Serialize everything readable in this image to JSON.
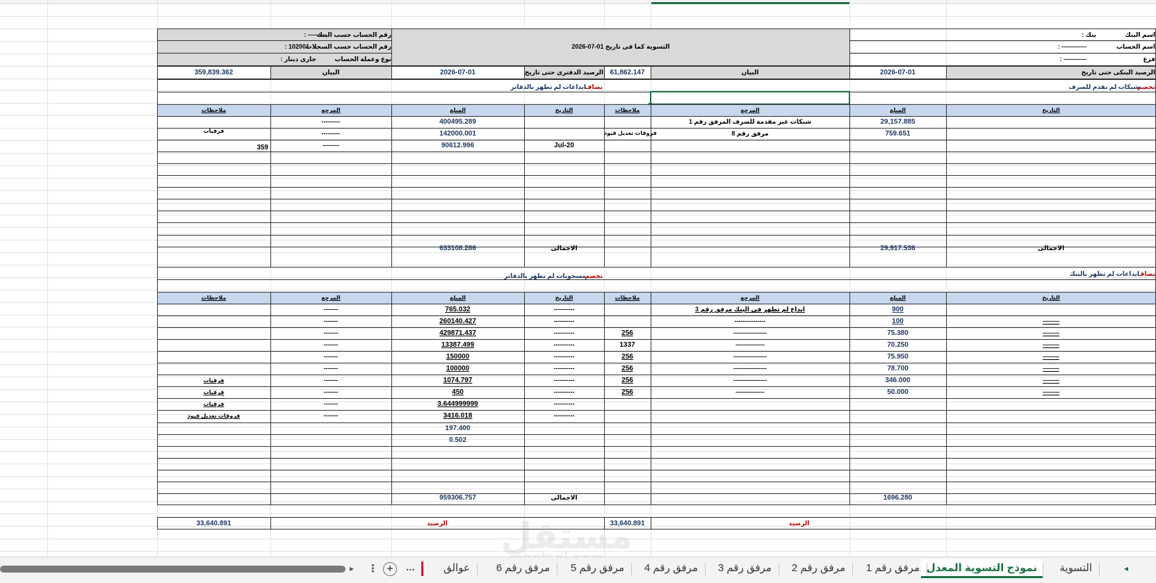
{
  "header": {
    "bank_name_label": "اسم البنك",
    "bank_name_value": ": بنك",
    "account_name_label": "اسم الحساب",
    "account_name_value": ": ------------",
    "branch_label": "فرع",
    "branch_value": ": -----------",
    "reconciliation_title": "التسوية كما فى تاريخ 01-07-2026",
    "acct_by_bank_label": "رقم الحساب حسب البنك",
    "acct_by_bank_value": ": ---------",
    "acct_by_records_label": "رقم الحساب حسب السجلات",
    "acct_by_records_value": ": 102001",
    "acct_type_label": "نوع وعملة الحساب",
    "acct_type_value": ": جارى دينار"
  },
  "balances": {
    "bank_balance_label": "الرصيد البنكى حتى تاريخ",
    "bank_date": "2026-07-01",
    "statement_label_right": "البيان",
    "bank_balance_value": "61,862.147",
    "book_balance_label": "الرصيد الدفترى حتى تاريخ",
    "book_date": "2026-07-01",
    "statement_label_left": "البيان",
    "book_balance_value": "359,839.362"
  },
  "section1": {
    "right_title_red": "تخصم",
    "right_title_blue": "شيكات لم تقدم للصرف",
    "left_title_red": "يضاف",
    "left_title_blue": "ايداعات لم تظهر بالدفاتر"
  },
  "columns": {
    "date": "التاريخ",
    "amount": "المبلغ",
    "reference": "المرجع",
    "notes": "ملاحظات"
  },
  "section1_right_rows": [
    {
      "amount": "29,157.885",
      "reference": "شيكات غير مقدمة للصرف المرفق رقم 1",
      "notes": ""
    },
    {
      "amount": "759.651",
      "reference": "مرفق رقم 8",
      "notes": "فروقات تعديل قيود"
    }
  ],
  "section1_left_rows": [
    {
      "date": "",
      "amount": "400495.289",
      "reference": "---------",
      "notes": ""
    },
    {
      "date": "",
      "amount": "142000.001",
      "reference": "---------",
      "notes": "فرقيات"
    },
    {
      "date": "Jul-20",
      "amount": "90612.996",
      "reference": "--------",
      "notes": "359"
    }
  ],
  "section1_totals": {
    "label": "الاجمالى",
    "right_total": "29,917.536",
    "left_total": "633108.286"
  },
  "section2": {
    "right_title_red": "يضاف",
    "right_title_blue": "ايداعات لم تظهر بالبنك",
    "left_title_red": "تخصم",
    "left_title_blue": "مسحوبات لم تظهر بالدفاتر"
  },
  "section2_right_rows": [
    {
      "date": "",
      "amount": "900",
      "reference": "ايداع لم تظهر فى البنك مرفق رقم 3",
      "notes": ""
    },
    {
      "date": "--------",
      "amount": "100",
      "reference": "---------------",
      "notes": ""
    },
    {
      "date": "--------",
      "amount": "75.380",
      "reference": "----------------",
      "notes": "256"
    },
    {
      "date": "--------",
      "amount": "70.250",
      "reference": "--------------",
      "notes": "1337"
    },
    {
      "date": "--------",
      "amount": "75.950",
      "reference": "----------------",
      "notes": "256"
    },
    {
      "date": "--------",
      "amount": "78.700",
      "reference": "----------------",
      "notes": "256"
    },
    {
      "date": "--------",
      "amount": "346.000",
      "reference": "----------------",
      "notes": "256"
    },
    {
      "date": "--------",
      "amount": "50.000",
      "reference": "--------------",
      "notes": "256"
    }
  ],
  "section2_left_rows": [
    {
      "date": "----------",
      "amount": "765.032",
      "reference": "-------",
      "notes": ""
    },
    {
      "date": "----------",
      "amount": "260140.427",
      "reference": "-------",
      "notes": ""
    },
    {
      "date": "----------",
      "amount": "429871.437",
      "reference": "-------",
      "notes": ""
    },
    {
      "date": "----------",
      "amount": "13387.499",
      "reference": "-------",
      "notes": ""
    },
    {
      "date": "----------",
      "amount": "150000",
      "reference": "-------",
      "notes": ""
    },
    {
      "date": "----------",
      "amount": "100000",
      "reference": "-------",
      "notes": ""
    },
    {
      "date": "----------",
      "amount": "1074.797",
      "reference": "-------",
      "notes": "فرقيات"
    },
    {
      "date": "----------",
      "amount": "450",
      "reference": "-------",
      "notes": "فرقيات"
    },
    {
      "date": "----------",
      "amount": "3.644999999",
      "reference": "-------",
      "notes": "فرقيات"
    },
    {
      "date": "----------",
      "amount": "3416.018",
      "reference": "-------",
      "notes": "فروقات تعديل قيود"
    },
    {
      "date": "",
      "amount": "197.400",
      "reference": "",
      "notes": ""
    },
    {
      "date": "",
      "amount": "0.502",
      "reference": "",
      "notes": ""
    }
  ],
  "section2_totals": {
    "label": "الاجمالى",
    "right_total": "1696.280",
    "left_total": "959306.757"
  },
  "final": {
    "label": "الرصيد",
    "right_value": "33,640.891",
    "left_value": "33,640.891"
  },
  "tabs": [
    {
      "label": "التسوية",
      "active": false
    },
    {
      "label": "نموذج التسوية المعدل",
      "active": true
    },
    {
      "label": "مرفق رقم 1",
      "active": false
    },
    {
      "label": "مرفق رقم 2",
      "active": false
    },
    {
      "label": "مرفق رقم 3",
      "active": false
    },
    {
      "label": "مرفق رقم 4",
      "active": false
    },
    {
      "label": "مرفق رقم 5",
      "active": false
    },
    {
      "label": "مرفق رقم 6",
      "active": false
    },
    {
      "label": "عوالق",
      "active": false
    }
  ],
  "tab_controls": {
    "more": "...",
    "add": "+",
    "options": "⋮",
    "scroll_left": "◂",
    "scroll_right": "▸"
  },
  "watermark": {
    "line1": "مستقل",
    "line2": "mostaql.com"
  }
}
